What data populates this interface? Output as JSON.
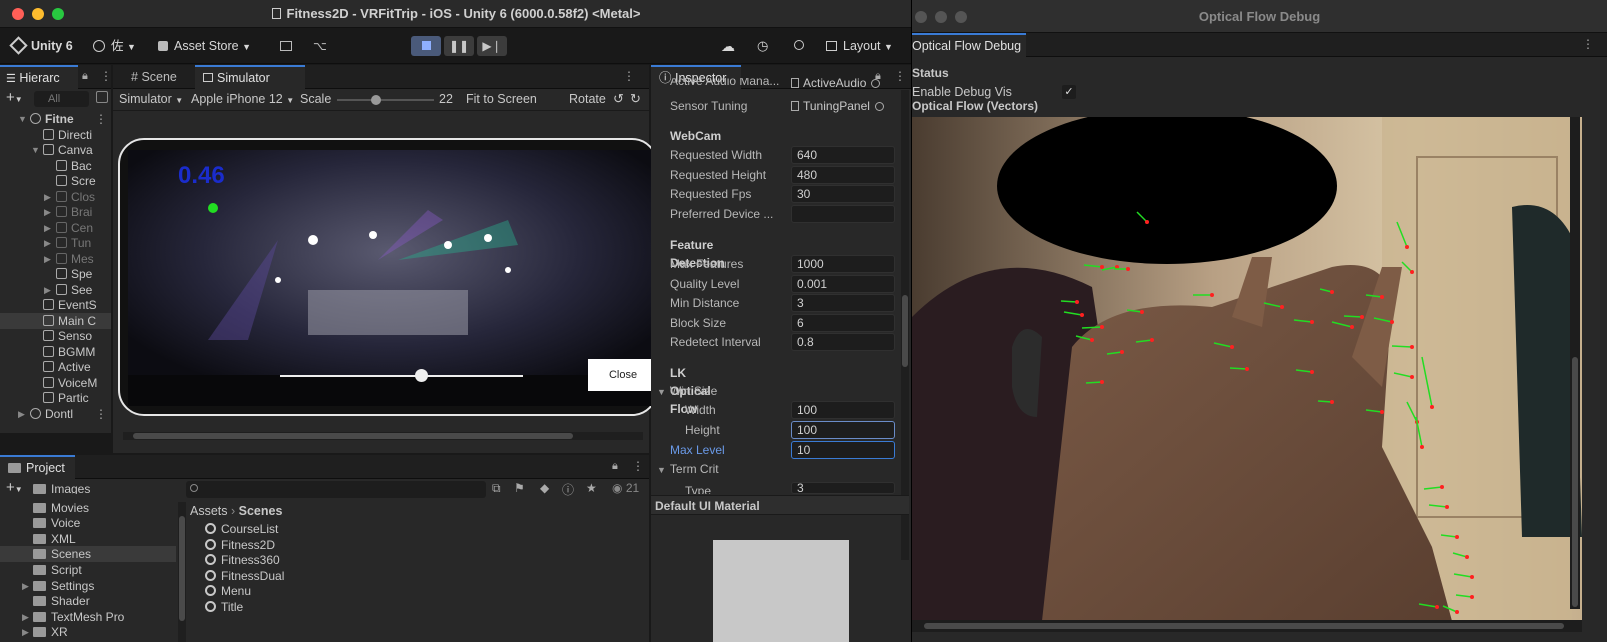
{
  "window": {
    "title": "Fitness2D - VRFitTrip - iOS - Unity 6 (6000.0.58f2) <Metal>",
    "colors": {
      "close": "#ff5f57",
      "minimize": "#febc2e",
      "maximize": "#28c840",
      "accent": "#3a7bd5"
    }
  },
  "toolbar": {
    "unity_label": "Unity 6",
    "account_label": "佐",
    "asset_store_label": "Asset Store",
    "layout_label": "Layout"
  },
  "hierarchy": {
    "tab_label": "Hierarc",
    "search_placeholder": "All",
    "items": [
      {
        "label": "Fitne",
        "bold": true
      },
      {
        "label": "Directi"
      },
      {
        "label": "Canva"
      },
      {
        "label": "Bac"
      },
      {
        "label": "Scre"
      },
      {
        "label": "Clos"
      },
      {
        "label": "Brai"
      },
      {
        "label": "Cen"
      },
      {
        "label": "Tun"
      },
      {
        "label": "Mes"
      },
      {
        "label": "Spe"
      },
      {
        "label": "See"
      },
      {
        "label": "EventS"
      },
      {
        "label": "Main C"
      },
      {
        "label": "Senso"
      },
      {
        "label": "BGMM"
      },
      {
        "label": "Active"
      },
      {
        "label": "VoiceM"
      },
      {
        "label": "Partic"
      },
      {
        "label": "Dontl"
      }
    ]
  },
  "scene_tabs": {
    "scene": "Scene",
    "simulator": "Simulator"
  },
  "simulator": {
    "mode": "Simulator",
    "device": "Apple iPhone 12",
    "scale_label": "Scale",
    "scale_value": "22",
    "scale_fraction": 0.4,
    "fit_label": "Fit to Screen",
    "rotate_label": "Rotate",
    "overlay_value": "0.46",
    "close_label": "Close",
    "slider_fraction": 0.58
  },
  "inspector": {
    "tab_label": "Inspector",
    "rows_top": [
      {
        "label": "Active Audio Mana...",
        "value": "ActiveAudio"
      },
      {
        "label": "Sensor Tuning",
        "value": "TuningPanel"
      }
    ],
    "webcam_header": "WebCam",
    "webcam": [
      {
        "label": "Requested Width",
        "value": "640"
      },
      {
        "label": "Requested Height",
        "value": "480"
      },
      {
        "label": "Requested Fps",
        "value": "30"
      },
      {
        "label": "Preferred Device ...",
        "value": ""
      }
    ],
    "feature_header": "Feature Detection",
    "feature": [
      {
        "label": "Max Features",
        "value": "1000"
      },
      {
        "label": "Quality Level",
        "value": "0.001"
      },
      {
        "label": "Min Distance",
        "value": "3"
      },
      {
        "label": "Block Size",
        "value": "6"
      },
      {
        "label": "Redetect Interval",
        "value": "0.8"
      }
    ],
    "lk_header": "LK Optical Flow",
    "win_size_label": "Win Size",
    "width_label": "Width",
    "width_value": "100",
    "height_label": "Height",
    "height_value": "100",
    "max_level_label": "Max Level",
    "max_level_value": "10",
    "term_crit_label": "Term Crit",
    "type_label": "Type",
    "type_value": "3",
    "material_label": "Default UI Material"
  },
  "project": {
    "tab_label": "Project",
    "count": "21",
    "breadcrumb_root": "Assets",
    "breadcrumb_current": "Scenes",
    "folders": [
      "Images",
      "Movies",
      "Voice",
      "XML",
      "Scenes",
      "Script",
      "Settings",
      "Shader",
      "TextMesh Pro",
      "XR"
    ],
    "scenes": [
      "CourseList",
      "Fitness2D",
      "Fitness360",
      "FitnessDual",
      "Menu",
      "Title"
    ]
  },
  "debug": {
    "window_title": "Optical Flow Debug",
    "tab_label": "Optical Flow Debug",
    "status_label": "Status",
    "enable_label": "Enable Debug Vis",
    "enable_checked": true,
    "vectors_label": "Optical Flow (Vectors)",
    "vector_color": "#22dd22",
    "point_color": "#ff2020"
  }
}
